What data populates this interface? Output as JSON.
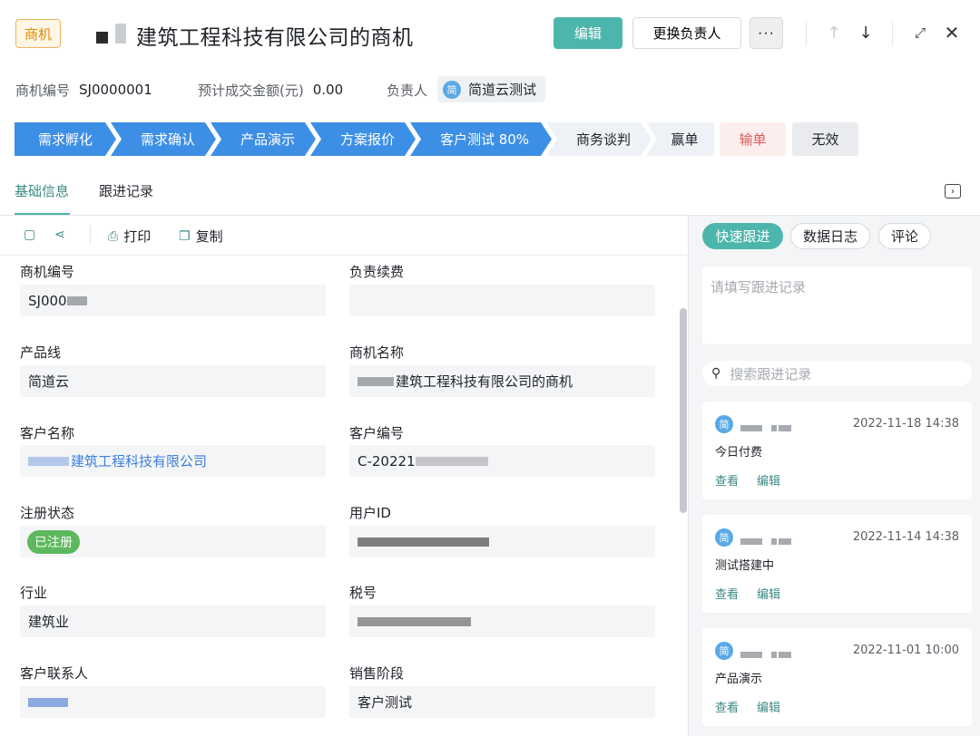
{
  "header": {
    "tag": "商机",
    "title": "建筑工程科技有限公司的商机",
    "edit_label": "编辑",
    "change_owner_label": "更换负责人",
    "more_label": "···",
    "icons": [
      "arrow-up-icon",
      "arrow-down-icon",
      "expand-icon",
      "close-icon"
    ]
  },
  "summary": {
    "id_label": "商机编号",
    "id_value": "SJ0000001",
    "amount_label": "预计成交金额(元)",
    "amount_value": "0.00",
    "owner_label": "负责人",
    "owner_avatar": "简",
    "owner_name": "简道云测试"
  },
  "stages": {
    "items": [
      {
        "label": "需求孵化",
        "done": true
      },
      {
        "label": "需求确认",
        "done": true
      },
      {
        "label": "产品演示",
        "done": true
      },
      {
        "label": "方案报价",
        "done": true
      },
      {
        "label": "客户测试 80%",
        "done": true
      },
      {
        "label": "商务谈判",
        "done": false
      },
      {
        "label": "赢单",
        "done": false
      }
    ],
    "lose_label": "输单",
    "invalid_label": "无效",
    "colors": {
      "done": "#3d8fe6",
      "todo": "#eef2f6",
      "lose_bg": "#fdeeee",
      "lose_text": "#e05a5a",
      "invalid_bg": "#e9ebee"
    }
  },
  "tabs": {
    "basic": "基础信息",
    "followup": "跟进记录"
  },
  "toolbar": {
    "print_label": "打印",
    "copy_label": "复制"
  },
  "fields": {
    "opp_id_label": "商机编号",
    "opp_id_value": "SJ000",
    "renewal_label": "负责续费",
    "renewal_value": "",
    "product_line_label": "产品线",
    "product_line_value": "简道云",
    "opp_name_label": "商机名称",
    "opp_name_value": "建筑工程科技有限公司的商机",
    "customer_name_label": "客户名称",
    "customer_name_value": "建筑工程科技有限公司",
    "customer_id_label": "客户编号",
    "customer_id_value": "C-20221",
    "reg_status_label": "注册状态",
    "reg_status_value": "已注册",
    "user_id_label": "用户ID",
    "industry_label": "行业",
    "industry_value": "建筑业",
    "tax_label": "税号",
    "contact_label": "客户联系人",
    "sales_stage_label": "销售阶段",
    "sales_stage_value": "客户测试"
  },
  "right_panel": {
    "tab_quick": "快速跟进",
    "tab_log": "数据日志",
    "tab_comment": "评论",
    "note_placeholder": "请填写跟进记录",
    "search_placeholder": "搜索跟进记录",
    "records": [
      {
        "avatar": "简",
        "time": "2022-11-18 14:38",
        "text": "今日付费",
        "view": "查看",
        "edit": "编辑"
      },
      {
        "avatar": "简",
        "time": "2022-11-14 14:38",
        "text": "测试搭建中",
        "view": "查看",
        "edit": "编辑"
      },
      {
        "avatar": "简",
        "time": "2022-11-01 10:00",
        "text": "产品演示",
        "view": "查看",
        "edit": "编辑"
      }
    ]
  }
}
